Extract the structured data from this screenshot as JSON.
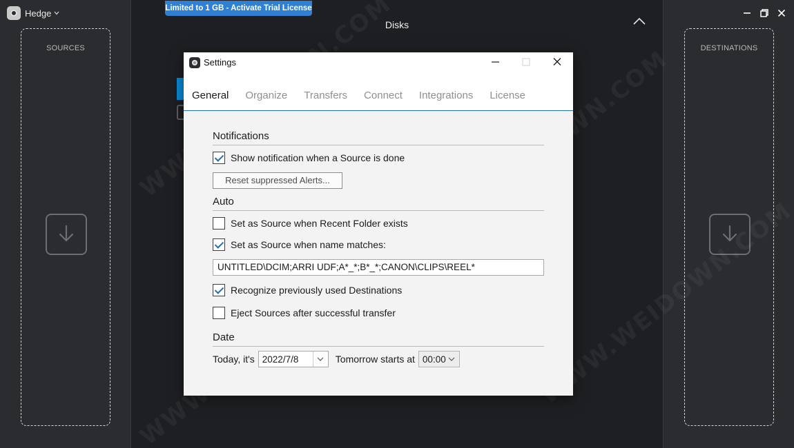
{
  "app": {
    "name": "Hedge",
    "trial_banner": "Limited to 1 GB - Activate Trial License",
    "center_title": "Disks"
  },
  "sources": {
    "label": "SOURCES",
    "icon": "download-arrow-icon"
  },
  "destinations": {
    "label": "DESTINATIONS",
    "icon": "download-arrow-icon"
  },
  "window_controls": [
    "minimize-icon",
    "restore-icon",
    "close-icon"
  ],
  "settings": {
    "title": "Settings",
    "tabs": [
      {
        "label": "General",
        "active": true
      },
      {
        "label": "Organize",
        "active": false
      },
      {
        "label": "Transfers",
        "active": false
      },
      {
        "label": "Connect",
        "active": false
      },
      {
        "label": "Integrations",
        "active": false
      },
      {
        "label": "License",
        "active": false
      }
    ],
    "notifications": {
      "heading": "Notifications",
      "show_when_done": {
        "label": "Show notification when a Source is done",
        "checked": true
      },
      "reset_button": "Reset suppressed Alerts..."
    },
    "auto": {
      "heading": "Auto",
      "recent_folder": {
        "label": "Set as Source when Recent Folder exists",
        "checked": false
      },
      "name_matches": {
        "label": "Set as Source when name matches:",
        "checked": true
      },
      "pattern_value": "UNTITLED\\DCIM;ARRI UDF;A*_*;B*_*;CANON\\CLIPS\\REEL*",
      "recognize_destinations": {
        "label": "Recognize previously used Destinations",
        "checked": true
      },
      "eject_sources": {
        "label": "Eject Sources after successful transfer",
        "checked": false
      }
    },
    "date": {
      "heading": "Date",
      "today_label": "Today, it's",
      "today_value": "2022/7/8",
      "tomorrow_label": "Tomorrow starts at",
      "tomorrow_value": "00:00"
    }
  },
  "colors": {
    "accent": "#2f7fd3",
    "check_blue": "#1f6fbf",
    "panel_bg": "#2b2c2f",
    "center_bg": "#1e1f22"
  }
}
